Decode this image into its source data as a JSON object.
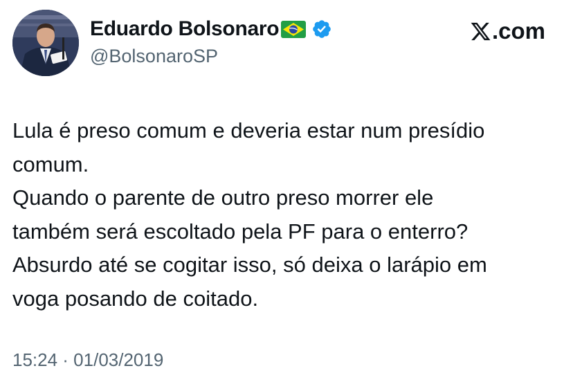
{
  "tweet": {
    "author": {
      "display_name": "Eduardo Bolsonaro",
      "handle": "@BolsonaroSP",
      "flag_icon": "brazil-flag-icon",
      "verified_icon": "verified-badge-icon",
      "verified_color": "#1d9bf0"
    },
    "brand": {
      "icon": "x-logo-icon",
      "text": ".com"
    },
    "text_lines": [
      "Lula é preso comum e deveria estar num presídio",
      "comum.",
      "Quando o parente de outro preso morrer ele",
      "também será escoltado pela PF para o enterro?",
      "Absurdo até se cogitar isso, só deixa o larápio em",
      "voga posando de coitado."
    ],
    "timestamp": "15:24 · 01/03/2019"
  }
}
